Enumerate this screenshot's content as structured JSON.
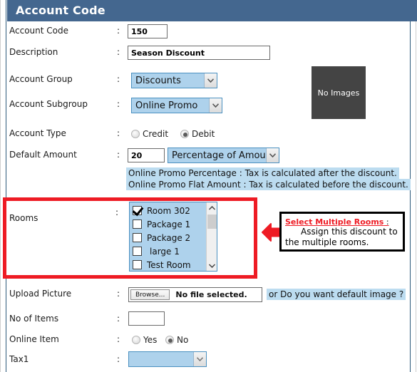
{
  "window": {
    "title": "Account Code"
  },
  "form": {
    "account_code": {
      "label": "Account Code",
      "colon": ":",
      "value": "150"
    },
    "description": {
      "label": "Description",
      "colon": ":",
      "value": "Season Discount"
    },
    "account_group": {
      "label": "Account Group",
      "colon": ":",
      "value": "Discounts"
    },
    "account_subgroup": {
      "label": "Account Subgroup",
      "colon": ":",
      "value": "Online Promo"
    },
    "account_type": {
      "label": "Account Type",
      "colon": ":",
      "options": [
        {
          "label": "Credit",
          "selected": false
        },
        {
          "label": "Debit",
          "selected": true
        }
      ]
    },
    "default_amount": {
      "label": "Default Amount",
      "colon": ":",
      "value": "20",
      "mode": "Percentage of Amount"
    },
    "info": {
      "line1": "Online Promo Percentage : Tax is calculated after the discount.",
      "line2": "Online Promo Flat Amount : Tax is calculated before the discount."
    },
    "rooms": {
      "label": "Rooms",
      "colon": ":",
      "items": [
        {
          "label": "Room 302",
          "checked": true
        },
        {
          "label": "Package 1",
          "checked": false
        },
        {
          "label": "Package 2",
          "checked": false
        },
        {
          "label": "large 1",
          "checked": false
        },
        {
          "label": "Test Room",
          "checked": false
        }
      ]
    },
    "upload_picture": {
      "label": "Upload Picture",
      "colon": ":",
      "browse_label": "Browse...",
      "file_status": "No file selected.",
      "default_image_prompt": "or Do you want default image ?"
    },
    "no_of_items": {
      "label": "No of Items",
      "colon": ":",
      "value": ""
    },
    "online_item": {
      "label": "Online Item",
      "colon": ":",
      "options": [
        {
          "label": "Yes",
          "selected": false
        },
        {
          "label": "No",
          "selected": true
        }
      ]
    },
    "tax1": {
      "label": "Tax1",
      "colon": ":",
      "value": ""
    }
  },
  "image_placeholder": {
    "text": "No Images"
  },
  "annotation": {
    "title": "Select Multiple Rooms",
    "title_colon": " :",
    "body": "Assign this discount to the multiple rooms."
  },
  "colors": {
    "header_blue": "#44678f",
    "select_blue": "#aed2ec",
    "highlight_blue": "#bcdcf0",
    "annotation_red": "#ee1b24",
    "placeholder_gray": "#444444"
  }
}
